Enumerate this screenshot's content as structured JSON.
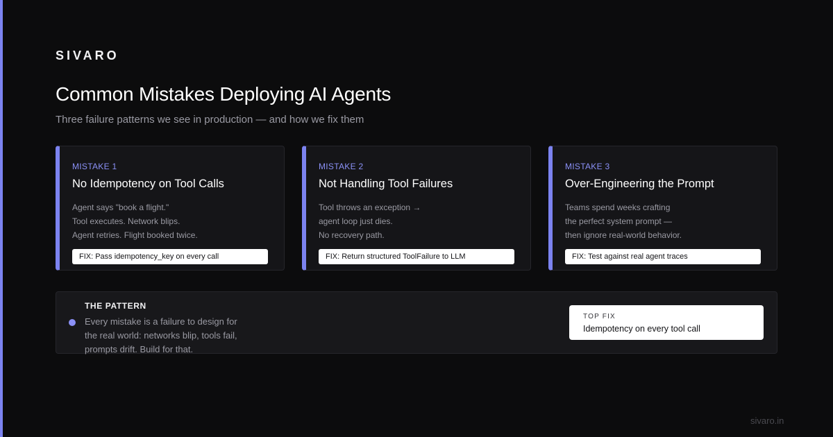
{
  "brand": "SIVARO",
  "title": "Common Mistakes Deploying AI Agents",
  "subtitle": "Three failure patterns we see in production — and how we fix them",
  "accent_color": "#7c83f0",
  "cards": [
    {
      "label": "MISTAKE 1",
      "title": "No Idempotency on Tool Calls",
      "lines": [
        "Agent says \"book a flight.\"",
        "Tool executes. Network blips.",
        "Agent retries. Flight booked twice."
      ],
      "fix": "FIX: Pass idempotency_key on every call"
    },
    {
      "label": "MISTAKE 2",
      "title": "Not Handling Tool Failures",
      "lines": [
        "Tool throws an exception →",
        "agent loop just dies.",
        "No recovery path."
      ],
      "fix": "FIX: Return structured ToolFailure to LLM"
    },
    {
      "label": "MISTAKE 3",
      "title": "Over-Engineering the Prompt",
      "lines": [
        "Teams spend weeks crafting",
        "the perfect system prompt —",
        "then ignore real-world behavior."
      ],
      "fix": "FIX: Test against real agent traces"
    }
  ],
  "pattern": {
    "title": "THE PATTERN",
    "lines": [
      "Every mistake is a failure to design for",
      "the real world: networks blip, tools fail,",
      "prompts drift. Build for that."
    ]
  },
  "top_fix": {
    "label": "TOP FIX",
    "value": "Idempotency on every tool call"
  },
  "footer": "sivaro.in"
}
